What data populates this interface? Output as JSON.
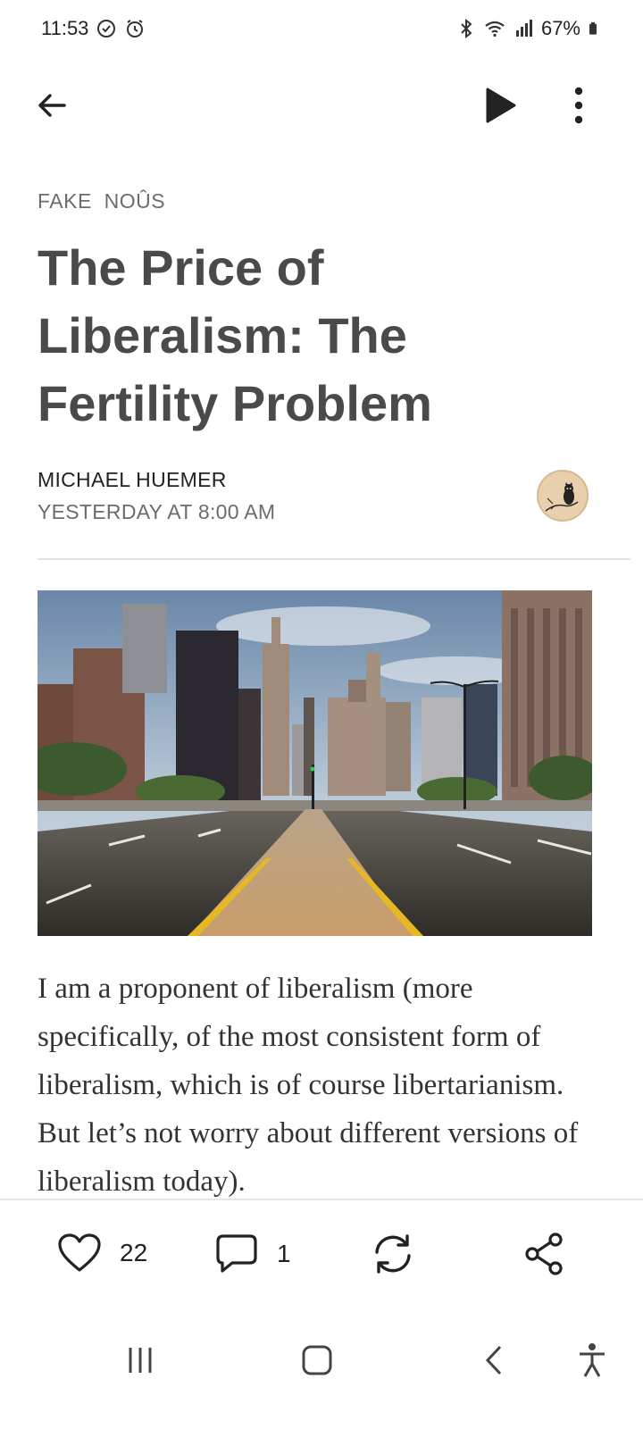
{
  "status_bar": {
    "time": "11:53",
    "battery": "67%"
  },
  "app_bar": {
    "back_icon": "arrow-left-icon",
    "play_icon": "play-icon",
    "more_icon": "more-vertical-icon"
  },
  "article": {
    "publication": "FAKE  NOÛS",
    "title": "The Price of Liberalism: The Fertility Problem",
    "author": "MICHAEL HUEMER",
    "date": "YESTERDAY AT 8:00 AM",
    "body": "I am a proponent of liberalism (more specifically, of the most consistent form of liberalism, which is of course libertarianism. But let’s not worry about different versions of liberalism today)."
  },
  "actions": {
    "like_count": "22",
    "comment_count": "1"
  },
  "colors": {
    "title": "#4a4a4a",
    "muted": "#6c6c6c",
    "avatar_bg": "#e8cfae"
  }
}
